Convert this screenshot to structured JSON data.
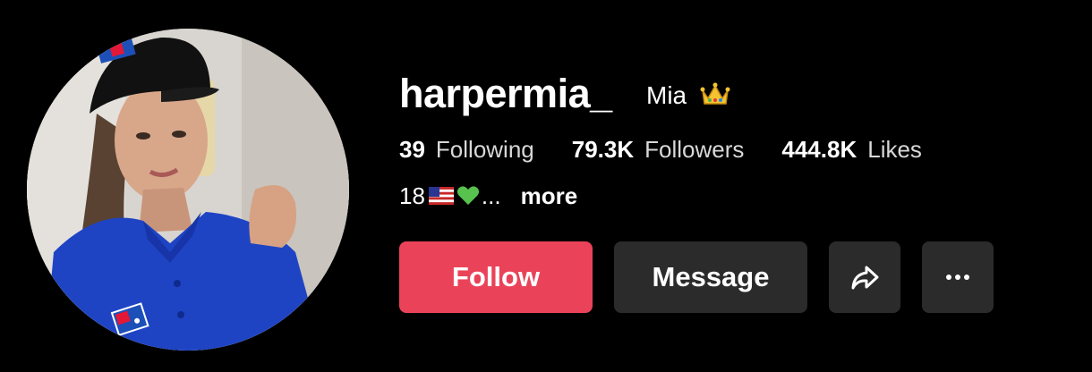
{
  "profile": {
    "username": "harpermia_",
    "nickname": "Mia",
    "nickname_emoji": "crown",
    "bio": {
      "text": "18",
      "emojis": [
        "us-flag",
        "green-heart"
      ],
      "ellipsis": "...",
      "more_label": "more"
    }
  },
  "stats": [
    {
      "value": "39",
      "label": "Following"
    },
    {
      "value": "79.3K",
      "label": "Followers"
    },
    {
      "value": "444.8K",
      "label": "Likes"
    }
  ],
  "actions": {
    "follow_label": "Follow",
    "message_label": "Message",
    "share_icon": "share-arrow-icon",
    "more_icon": "ellipsis-icon"
  },
  "colors": {
    "background": "#000000",
    "follow": "#ea4359",
    "secondary_button": "#2b2b2b",
    "text": "#ffffff"
  }
}
